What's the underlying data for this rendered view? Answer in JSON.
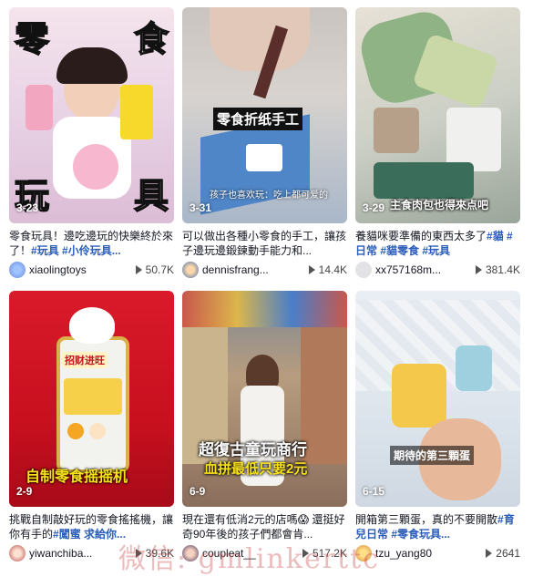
{
  "colors": {
    "hashtag": "#2b5db9",
    "accent": "#fe2c55"
  },
  "videos": [
    {
      "date": "3-23",
      "overlay": [
        "零",
        "食",
        "玩",
        "具"
      ],
      "desc_text": "零食玩具！邊吃邊玩的快樂終於來了！",
      "tags": "#玩具 #小伶玩具...",
      "author": "xiaolingtoys",
      "views": "50.7K"
    },
    {
      "date": "3-31",
      "overlay": [
        "零食折纸手工",
        "孩子也喜欢玩：吃上都可爱的"
      ],
      "desc_text": "可以做出各種小零食的手工，讓孩子邊玩邊鍛鍊動手能力和...",
      "tags": "",
      "author": "dennisfrang...",
      "views": "14.4K"
    },
    {
      "date": "3-29",
      "overlay": [
        "主食肉包也得來点吧"
      ],
      "desc_text": "養貓咪要準備的東西太多了",
      "tags": "#貓 #日常 #貓零食 #玩具",
      "author": "xx757168m...",
      "views": "381.4K"
    },
    {
      "date": "2-9",
      "overlay": [
        "自制零食摇摇机",
        "招财进旺"
      ],
      "desc_text": "挑戰自制敲好玩的零食搖搖機，讓你有手的",
      "tags": "#闖蜜 求給你...",
      "author": "yiwanchiba...",
      "views": "39.6K"
    },
    {
      "date": "6-9",
      "overlay": [
        "超復古童玩商行",
        "血拼最低只要2元"
      ],
      "desc_text": "現在還有低消2元的店嗎😱 還挺好奇90年後的孩子們都會肯...",
      "tags": "",
      "author": "coupleat__",
      "views": "517.2K"
    },
    {
      "date": "6-15",
      "overlay": [
        "期待的第三顆蛋"
      ],
      "desc_text": "開箱第三顆蛋，真的不要開散",
      "tags": "#育兒日常 #零食玩具...",
      "author": "tzu_yang80",
      "views": "2641"
    }
  ],
  "watermark": "微信: gmlinkerttc"
}
